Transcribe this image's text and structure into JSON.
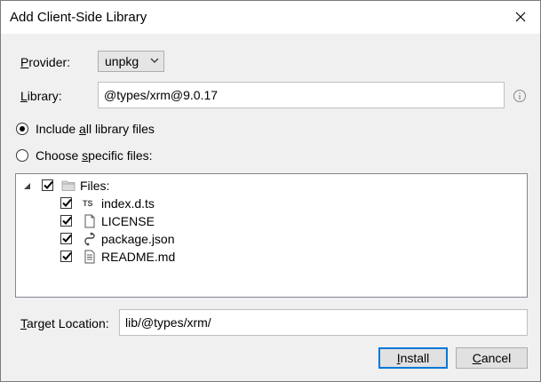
{
  "window": {
    "title": "Add Client-Side Library"
  },
  "provider": {
    "label_u": "P",
    "label_rest": "rovider:",
    "value": "unpkg"
  },
  "library": {
    "label_u": "L",
    "label_rest": "ibrary:",
    "value": "@types/xrm@9.0.17"
  },
  "options": {
    "include_all": {
      "pre": "Include ",
      "u": "a",
      "post": "ll library files",
      "checked": true
    },
    "choose_specific": {
      "pre": "Choose ",
      "u": "s",
      "post": "pecific files:",
      "checked": false
    }
  },
  "tree": {
    "root": {
      "label": "Files:",
      "checked": true,
      "expanded": true,
      "icon": "folder-icon"
    },
    "files": [
      {
        "name": "index.d.ts",
        "checked": true,
        "icon": "typescript-icon"
      },
      {
        "name": "LICENSE",
        "checked": true,
        "icon": "file-icon"
      },
      {
        "name": "package.json",
        "checked": true,
        "icon": "json-icon"
      },
      {
        "name": "README.md",
        "checked": true,
        "icon": "text-file-icon"
      }
    ]
  },
  "target": {
    "label_u": "T",
    "label_rest": "arget Location:",
    "value": "lib/@types/xrm/"
  },
  "buttons": {
    "install_u": "I",
    "install_rest": "nstall",
    "cancel_u": "C",
    "cancel_rest": "ancel"
  },
  "icons": {
    "close": "close-icon",
    "info": "info-icon",
    "chevron": "chevron-down-icon",
    "expander": "collapse-triangle-icon"
  },
  "colors": {
    "accent": "#0078d7",
    "titlebar": "#ffffff",
    "dialog_bg": "#f0f0f0"
  }
}
